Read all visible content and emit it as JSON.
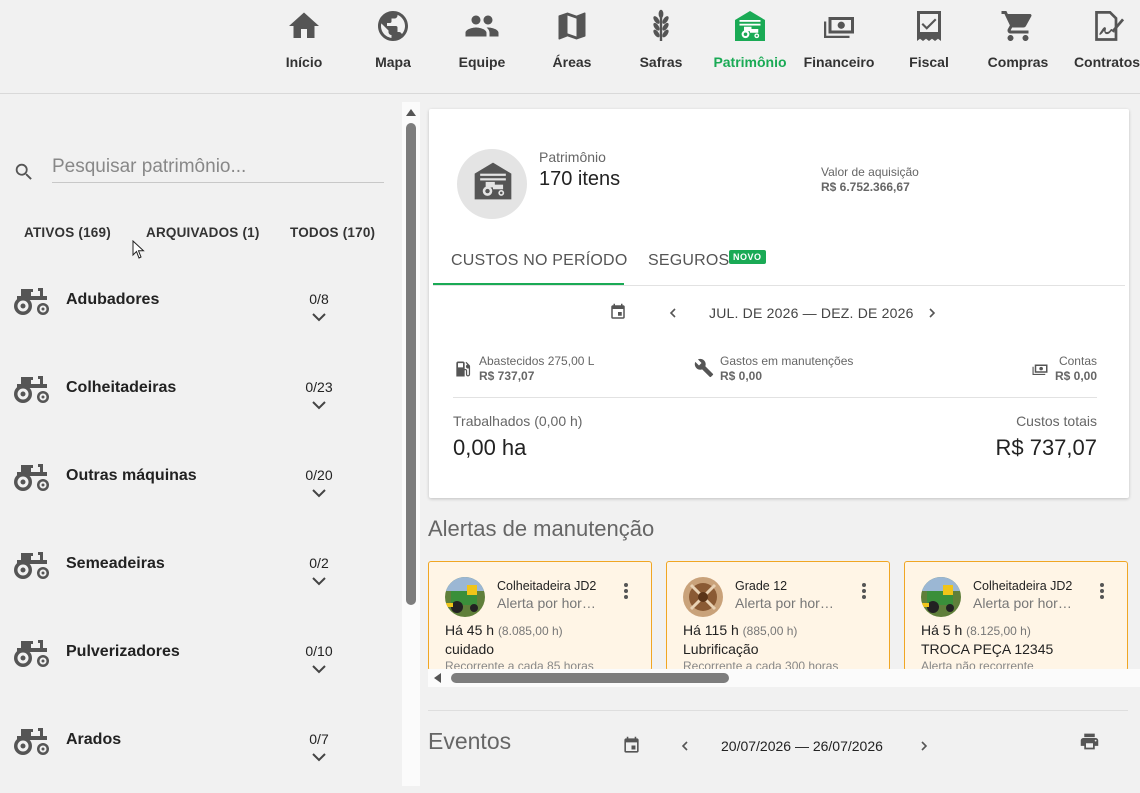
{
  "nav": {
    "items": [
      {
        "label": "Início",
        "icon": "home-icon"
      },
      {
        "label": "Mapa",
        "icon": "globe-icon"
      },
      {
        "label": "Equipe",
        "icon": "team-icon"
      },
      {
        "label": "Áreas",
        "icon": "map-icon"
      },
      {
        "label": "Safras",
        "icon": "wheat-icon"
      },
      {
        "label": "Patrimônio",
        "icon": "barn-tractor-icon"
      },
      {
        "label": "Financeiro",
        "icon": "money-icon"
      },
      {
        "label": "Fiscal",
        "icon": "receipt-icon"
      },
      {
        "label": "Compras",
        "icon": "cart-icon"
      },
      {
        "label": "Contratos",
        "icon": "contract-icon"
      }
    ],
    "active": "Patrimônio"
  },
  "search": {
    "placeholder": "Pesquisar patrimônio..."
  },
  "filters": [
    {
      "label": "ATIVOS (169)"
    },
    {
      "label": "ARQUIVADOS (1)"
    },
    {
      "label": "TODOS (170)"
    }
  ],
  "categories": [
    {
      "label": "Adubadores",
      "count": "0/8"
    },
    {
      "label": "Colheitadeiras",
      "count": "0/23"
    },
    {
      "label": "Outras máquinas",
      "count": "0/20"
    },
    {
      "label": "Semeadeiras",
      "count": "0/2"
    },
    {
      "label": "Pulverizadores",
      "count": "0/10"
    },
    {
      "label": "Arados",
      "count": "0/7"
    }
  ],
  "summary": {
    "label": "Patrimônio",
    "items": "170 itens",
    "acquisition_label": "Valor de aquisição",
    "acquisition_value": "R$ 6.752.366,67",
    "tabs": [
      "CUSTOS NO PERÍODO",
      "SEGUROS"
    ],
    "new_badge": "NOVO",
    "period": "JUL. DE 2026 — DEZ. DE 2026",
    "fuel_label": "Abastecidos 275,00 L",
    "fuel_value": "R$ 737,07",
    "maint_label": "Gastos em manutenções",
    "maint_value": "R$ 0,00",
    "accounts_label": "Contas",
    "accounts_value": "R$ 0,00",
    "worked_label": "Trabalhados (0,00 h)",
    "worked_value": "0,00 ha",
    "total_label": "Custos totais",
    "total_value": "R$ 737,07"
  },
  "alerts": {
    "title": "Alertas de manutenção",
    "cards": [
      {
        "name": "Colheitadeira JD2",
        "type": "Alerta por hor…",
        "when": "Há 45 h",
        "hours": "(8.085,00 h)",
        "task": "cuidado",
        "recurrence": "Recorrente a cada 85 horas"
      },
      {
        "name": "Grade 12",
        "type": "Alerta por hor…",
        "when": "Há 115 h",
        "hours": "(885,00 h)",
        "task": "Lubrificação",
        "recurrence": "Recorrente a cada 300 horas"
      },
      {
        "name": "Colheitadeira JD2",
        "type": "Alerta por hor…",
        "when": "Há 5 h",
        "hours": "(8.125,00 h)",
        "task": "TROCA PEÇA 12345",
        "recurrence": "Alerta não recorrente"
      }
    ]
  },
  "events": {
    "title": "Eventos",
    "period": "20/07/2026 — 26/07/2026"
  },
  "colors": {
    "accent": "#1aaa55",
    "alert_border": "#f0a623",
    "alert_bg": "#fff5e6",
    "icon": "#555555"
  }
}
